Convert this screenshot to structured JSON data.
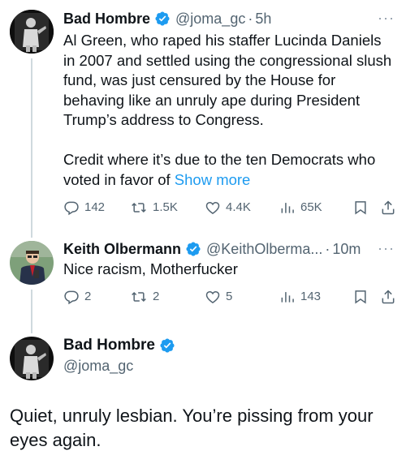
{
  "tweet1": {
    "name": "Bad Hombre",
    "handle": "@joma_gc",
    "separator": "·",
    "time": "5h",
    "more": "···",
    "text": "Al Green, who raped his staffer Lucinda Daniels in 2007 and settled using the congressional slush fund, was just censured by the House for behaving like an unruly ape during President Trump’s address to Congress.\n\nCredit where it’s due to the ten Democrats who voted in favor of ",
    "show_more": "Show more",
    "replies": "142",
    "reposts": "1.5K",
    "likes": "4.4K",
    "views": "65K"
  },
  "tweet2": {
    "name": "Keith Olbermann",
    "handle": "@KeithOlberma...",
    "separator": "·",
    "time": "10m",
    "more": "···",
    "text": "Nice racism, Motherfucker",
    "replies": "2",
    "reposts": "2",
    "likes": "5",
    "views": "143"
  },
  "tweet3": {
    "name": "Bad Hombre",
    "handle": "@joma_gc",
    "text": "Quiet, unruly lesbian. You’re pissing from your eyes again."
  },
  "colors": {
    "verified": "#1d9bf0",
    "link": "#1d9bf0",
    "secondary_text": "#536471",
    "thread_line": "#cfd9de"
  },
  "icons": [
    "reply-icon",
    "repost-icon",
    "like-icon",
    "views-icon",
    "bookmark-icon",
    "share-icon",
    "verified-badge-icon",
    "more-icon"
  ]
}
